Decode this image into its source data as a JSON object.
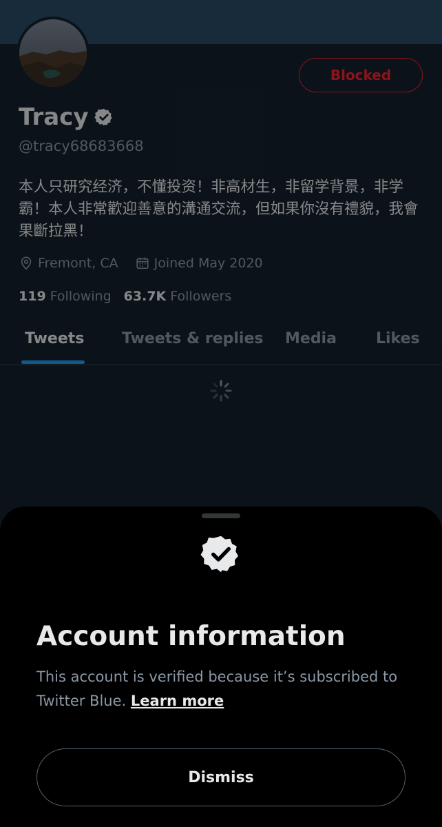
{
  "profile": {
    "blocked_label": "Blocked",
    "name": "Tracy",
    "handle": "@tracy68683668",
    "bio": "本人只研究经济，不懂投资！非高材生，非留学背景，非学霸！本人非常歡迎善意的溝通交流，但如果你沒有禮貌，我會果斷拉黑！",
    "location": "Fremont, CA",
    "joined": "Joined May 2020",
    "following_count": "119",
    "following_label": "Following",
    "followers_count": "63.7K",
    "followers_label": "Followers"
  },
  "tabs": [
    {
      "label": "Tweets",
      "active": true
    },
    {
      "label": "Tweets & replies",
      "active": false
    },
    {
      "label": "Media",
      "active": false
    },
    {
      "label": "Likes",
      "active": false
    }
  ],
  "sheet": {
    "title": "Account information",
    "description": "This account is verified because it’s subscribed to Twitter Blue.",
    "learn_more": "Learn more",
    "dismiss_label": "Dismiss"
  },
  "icons": {
    "verified": "verified-badge-icon",
    "location": "location-pin-icon",
    "calendar": "calendar-icon",
    "spinner": "loading-spinner-icon"
  },
  "colors": {
    "background": "#15202b",
    "accent": "#1d9bf0",
    "blocked": "#f4212e",
    "sheet": "#000000"
  }
}
